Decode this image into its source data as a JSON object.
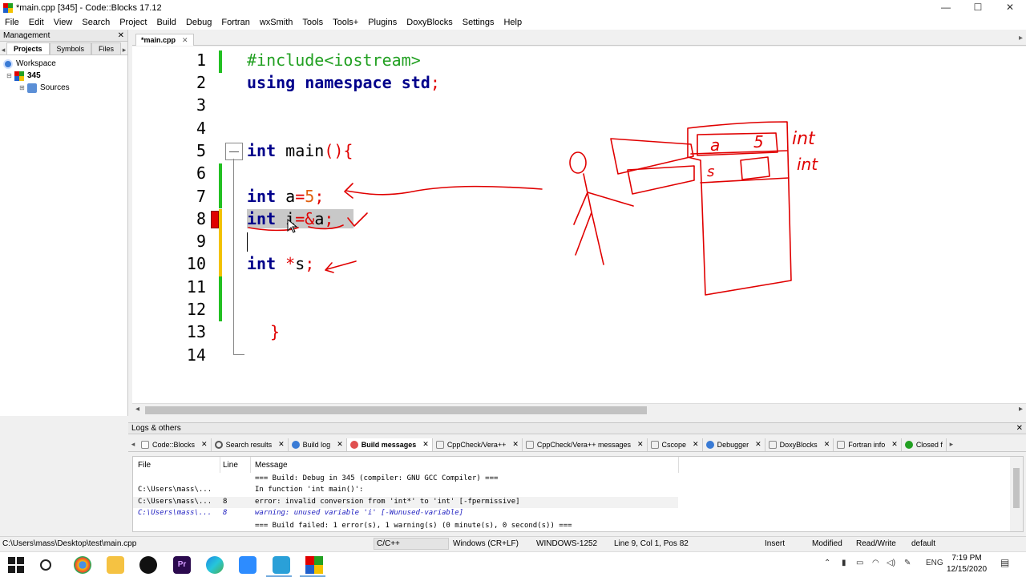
{
  "window": {
    "title": "*main.cpp [345] - Code::Blocks 17.12",
    "controls": {
      "minimize": "—",
      "maximize": "☐",
      "close": "✕"
    }
  },
  "menu": [
    "File",
    "Edit",
    "View",
    "Search",
    "Project",
    "Build",
    "Debug",
    "Fortran",
    "wxSmith",
    "Tools",
    "Tools+",
    "Plugins",
    "DoxyBlocks",
    "Settings",
    "Help"
  ],
  "management": {
    "title": "Management",
    "close": "✕",
    "tabs": [
      "Projects",
      "Symbols",
      "Files"
    ],
    "tree": {
      "workspace": "Workspace",
      "project": "345",
      "folder": "Sources"
    }
  },
  "editor": {
    "tab": "*main.cpp",
    "tab_close": "✕",
    "line_numbers": [
      "1",
      "2",
      "3",
      "4",
      "5",
      "6",
      "7",
      "8",
      "9",
      "10",
      "11",
      "12",
      "13",
      "14"
    ],
    "code": {
      "l1": "#include<iostream>",
      "l2_kw1": "using",
      "l2_kw2": "namespace",
      "l2_kw3": "std",
      "l2_end": ";",
      "l5_kw": "int",
      "l5_rest": " main",
      "l5_paren": "(){",
      "l7_kw": "int",
      "l7_var": " a",
      "l7_eq": "=",
      "l7_num": "5",
      "l7_end": ";",
      "l8_kw": "int",
      "l8_var": " i",
      "l8_eq": "=&",
      "l8_a": "a",
      "l8_end": ";",
      "l10_kw": "int",
      "l10_star": " *",
      "l10_var": "s",
      "l10_end": ";",
      "l13": "}"
    }
  },
  "logs": {
    "title": "Logs & others",
    "close": "✕",
    "tabs": [
      "Code::Blocks",
      "Search results",
      "Build log",
      "Build messages",
      "CppCheck/Vera++",
      "CppCheck/Vera++ messages",
      "Cscope",
      "Debugger",
      "DoxyBlocks",
      "Fortran info",
      "Closed f"
    ],
    "active_tab": "Build messages",
    "columns": [
      "File",
      "Line",
      "Message"
    ],
    "rows": [
      {
        "file": "",
        "line": "",
        "message": "=== Build: Debug in 345 (compiler: GNU GCC Compiler) ==="
      },
      {
        "file": "C:\\Users\\mass\\...",
        "line": "",
        "message": "In function 'int main()':"
      },
      {
        "file": "C:\\Users\\mass\\...",
        "line": "8",
        "message": "error: invalid conversion from 'int*' to 'int' [-fpermissive]"
      },
      {
        "file": "C:\\Users\\mass\\...",
        "line": "8",
        "message": "warning: unused variable 'i' [-Wunused-variable]"
      },
      {
        "file": "",
        "line": "",
        "message": "=== Build failed: 1 error(s), 1 warning(s) (0 minute(s), 0 second(s)) ==="
      }
    ]
  },
  "status": {
    "path": "C:\\Users\\mass\\Desktop\\test\\main.cpp",
    "language": "C/C++",
    "eol": "Windows (CR+LF)",
    "encoding": "WINDOWS-1252",
    "position": "Line 9, Col 1, Pos 82",
    "mode": "Insert",
    "modified": "Modified",
    "access": "Read/Write",
    "profile": "default"
  },
  "annotations": {
    "label1": "int",
    "label2": "int"
  },
  "taskbar": {
    "language": "ENG",
    "time": "7:19 PM",
    "date": "12/15/2020"
  },
  "colors": {
    "keyword": "#00008b",
    "preprocessor": "#22a022",
    "number": "#e06010",
    "operator": "#e00000",
    "pen": "#e00000"
  }
}
